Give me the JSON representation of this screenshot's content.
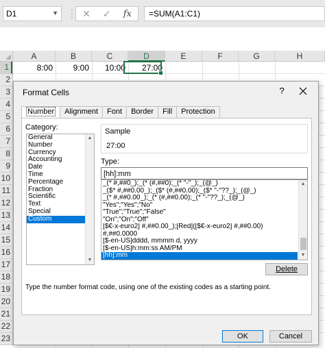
{
  "formula_bar": {
    "name_box": "D1",
    "cancel_symbol": "✕",
    "enter_symbol": "✓",
    "fx_label": "fx",
    "formula": "=SUM(A1:C1)"
  },
  "sheet": {
    "columns": [
      "A",
      "B",
      "C",
      "D",
      "E",
      "F",
      "G",
      "H"
    ],
    "selected_column": "D",
    "rows": [
      "1",
      "2",
      "3",
      "4",
      "5",
      "6",
      "7",
      "8",
      "9",
      "10",
      "11",
      "12",
      "13",
      "14",
      "15",
      "16",
      "17",
      "18",
      "19",
      "20",
      "21",
      "22",
      "23"
    ],
    "selected_row": "1",
    "row1_values": {
      "a": "8:00",
      "b": "9:00",
      "c": "10:00",
      "d": "27:00"
    },
    "accent_color": "#217346"
  },
  "dialog": {
    "title": "Format Cells",
    "help_symbol": "?",
    "tabs": [
      "Number",
      "Alignment",
      "Font",
      "Border",
      "Fill",
      "Protection"
    ],
    "active_tab": "Number",
    "category_label": "Category:",
    "categories": [
      "General",
      "Number",
      "Currency",
      "Accounting",
      "Date",
      "Time",
      "Percentage",
      "Fraction",
      "Scientific",
      "Text",
      "Special",
      "Custom"
    ],
    "selected_category": "Custom",
    "sample_label": "Sample",
    "sample_value": "27:00",
    "type_label": "Type:",
    "type_value": "[hh]:mm",
    "format_codes": [
      "_(* #,##0_);_(* (#,##0);_(* \"-\"_);_(@_)",
      "_($* #,##0.00_);_($* (#,##0.00);_($* \"-\"??_);_(@_)",
      "_(* #,##0.00_);_(* (#,##0.00);_(* \"-\"??_);_(@_)",
      "\"Yes\";\"Yes\";\"No\"",
      "\"True\";\"True\";\"False\"",
      "\"On\";\"On\";\"Off\"",
      "[$€-x-euro2] #,##0.00_);[Red]([$€-x-euro2] #,##0.00)",
      "#,##0.0000",
      "[$-en-US]dddd, mmmm d, yyyy",
      "[$-en-US]h:mm:ss AM/PM",
      "[hh]:mm"
    ],
    "selected_format": "[hh]:mm",
    "delete_label": "Delete",
    "hint": "Type the number format code, using one of the existing codes as a starting point.",
    "ok_label": "OK",
    "cancel_label": "Cancel",
    "selection_color": "#0078d7"
  }
}
